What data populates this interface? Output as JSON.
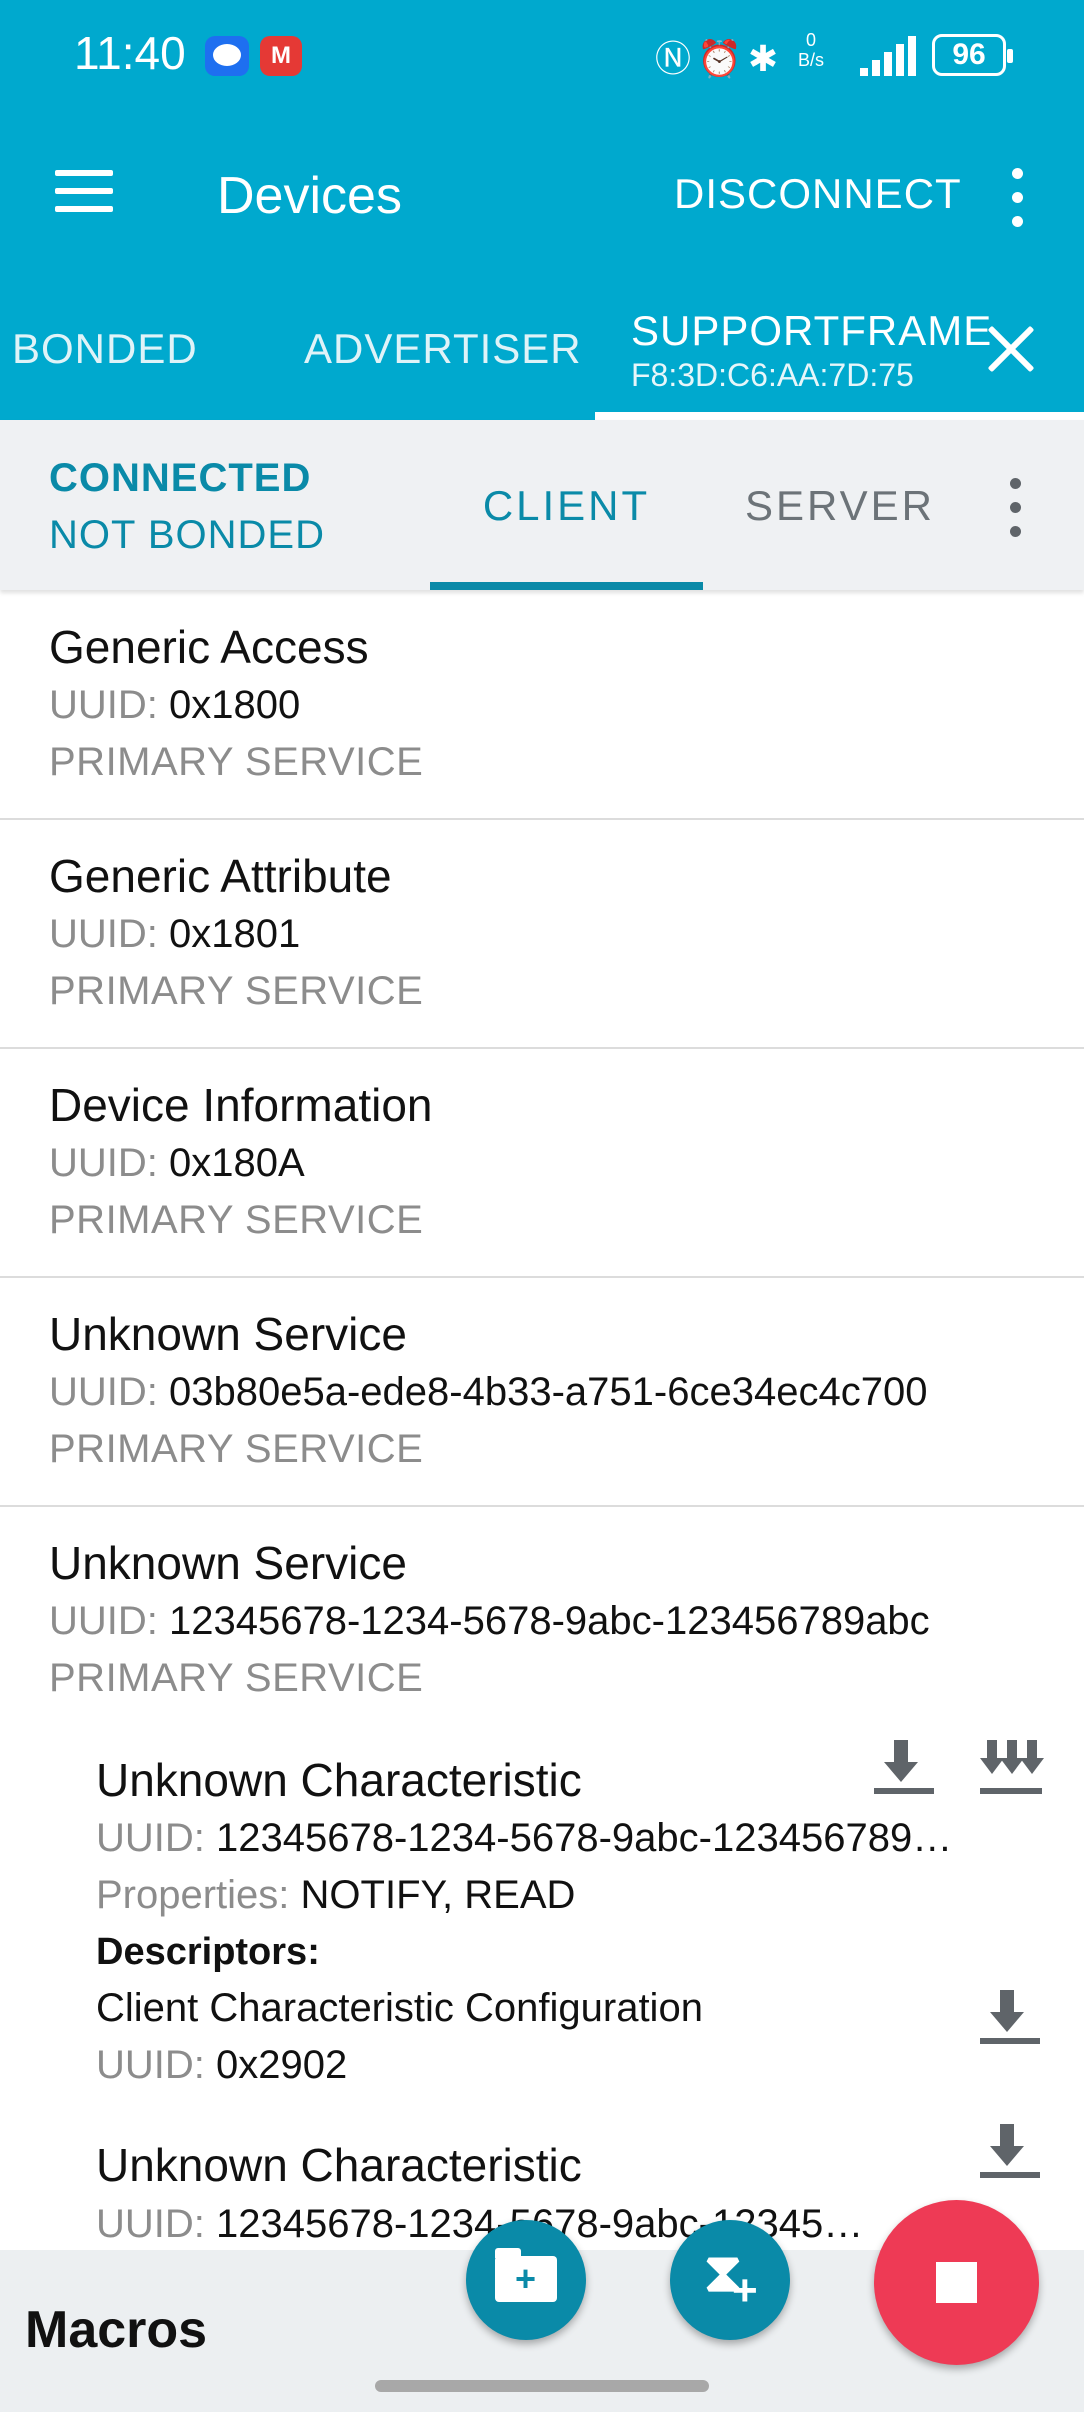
{
  "status_bar": {
    "time": "11:40",
    "app_icon_2": "M",
    "net_speed_value": "0",
    "net_speed_unit": "B/s",
    "battery": "96",
    "icons": [
      "nfc-icon",
      "alarm-icon",
      "bluetooth-icon",
      "signal-icon",
      "battery-icon"
    ]
  },
  "app_bar": {
    "title": "Devices",
    "action": "DISCONNECT"
  },
  "device_tabs": {
    "bonded": "BONDED",
    "advertiser": "ADVERTISER",
    "active_name": "SUPPORTFRAME",
    "active_mac": "F8:3D:C6:AA:7D:75"
  },
  "connection": {
    "state": "CONNECTED",
    "bond": "NOT BONDED",
    "tab_client": "CLIENT",
    "tab_server": "SERVER"
  },
  "labels": {
    "uuid": "UUID:",
    "properties": "Properties:",
    "descriptors": "Descriptors:"
  },
  "services": [
    {
      "name": "Generic Access",
      "uuid": "0x1800",
      "type": "PRIMARY SERVICE"
    },
    {
      "name": "Generic Attribute",
      "uuid": "0x1801",
      "type": "PRIMARY SERVICE"
    },
    {
      "name": "Device Information",
      "uuid": "0x180A",
      "type": "PRIMARY SERVICE"
    },
    {
      "name": "Unknown Service",
      "uuid": "03b80e5a-ede8-4b33-a751-6ce34ec4c700",
      "type": "PRIMARY SERVICE"
    },
    {
      "name": "Unknown Service",
      "uuid": "12345678-1234-5678-9abc-123456789abc",
      "type": "PRIMARY SERVICE"
    }
  ],
  "characteristics": [
    {
      "name": "Unknown Characteristic",
      "uuid": "12345678-1234-5678-9abc-123456789…",
      "properties": "NOTIFY, READ",
      "descriptor_name": "Client Characteristic Configuration",
      "descriptor_uuid": "0x2902"
    },
    {
      "name": "Unknown Characteristic",
      "uuid": "12345678-1234-5678-9abc-12345…"
    }
  ],
  "bottom": {
    "macros": "Macros"
  }
}
